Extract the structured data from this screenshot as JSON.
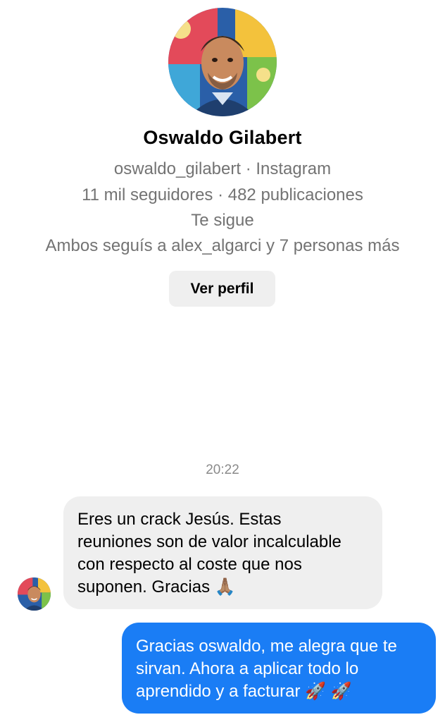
{
  "profile": {
    "avatar_icon": "profile-photo-oswaldo",
    "name": "Oswaldo Gilabert",
    "handle_line": "oswaldo_gilabert · Instagram",
    "stats_line": "11 mil seguidores · 482 publicaciones",
    "follows_you": "Te sigue",
    "mutual_line": "Ambos seguís a alex_algarci y 7 personas más",
    "view_profile_label": "Ver perfil"
  },
  "conversation": {
    "timestamp": "20:22",
    "incoming": {
      "lines": [
        "Eres un crack Jesús. Estas",
        "reuniones son de valor incalculable",
        "con respecto al coste que nos",
        "suponen. Gracias 🙏🏽"
      ]
    },
    "outgoing": {
      "lines": [
        "Gracias oswaldo, me alegra que te",
        "sirvan. Ahora a aplicar todo lo",
        "aprendido y a facturar 🚀 🚀"
      ]
    }
  },
  "colors": {
    "outgoing_bubble": "#1a7df5",
    "incoming_bubble": "#efefef",
    "secondary_text": "#737373"
  }
}
